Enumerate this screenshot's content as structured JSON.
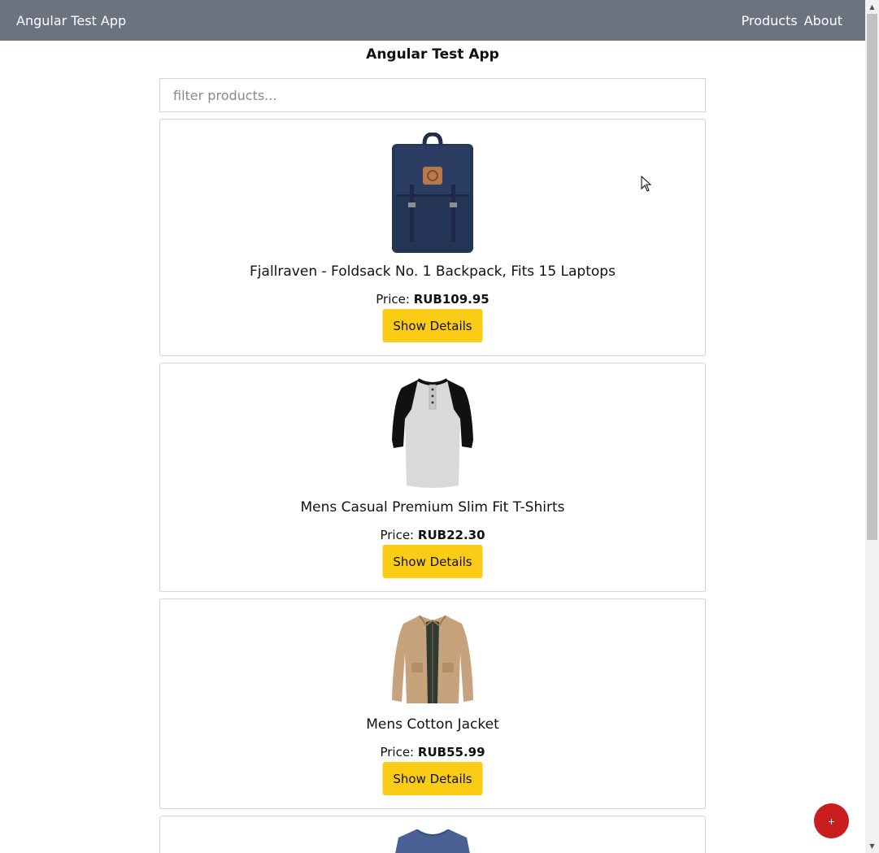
{
  "nav": {
    "brand": "Angular Test App",
    "links": [
      "Products",
      "About"
    ]
  },
  "page": {
    "title": "Angular Test App"
  },
  "filter": {
    "placeholder": "filter products...",
    "value": ""
  },
  "products": [
    {
      "title": "Fjallraven - Foldsack No. 1 Backpack, Fits 15 Laptops",
      "price_label": "Price:",
      "price": "RUB109.95",
      "button": "Show Details",
      "image": "backpack"
    },
    {
      "title": "Mens Casual Premium Slim Fit T-Shirts",
      "price_label": "Price:",
      "price": "RUB22.30",
      "button": "Show Details",
      "image": "raglan-tshirt"
    },
    {
      "title": "Mens Cotton Jacket",
      "price_label": "Price:",
      "price": "RUB55.99",
      "button": "Show Details",
      "image": "cotton-jacket"
    },
    {
      "image": "blue-tshirt"
    }
  ],
  "fab": {
    "label": "+"
  },
  "colors": {
    "navbar": "#6b7280",
    "button": "#facc15",
    "fab": "#c81e1e"
  }
}
